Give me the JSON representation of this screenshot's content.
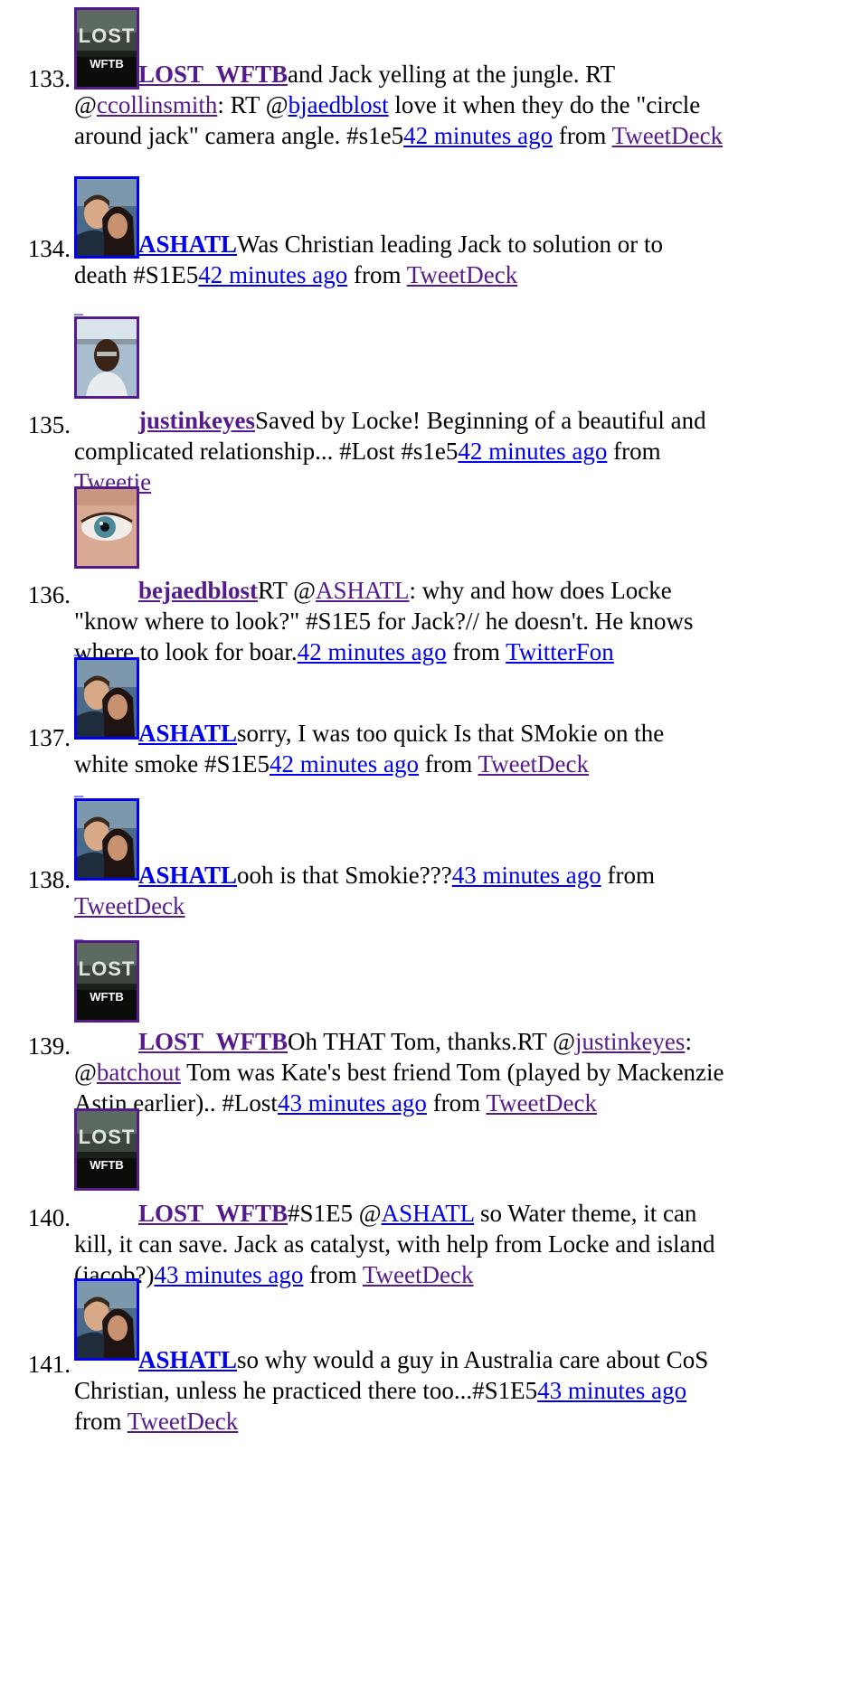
{
  "colors": {
    "link": "#0000ee",
    "visited": "#551a8b",
    "text": "#000000",
    "background": "#ffffff"
  },
  "tweets": [
    {
      "num": "133.",
      "avatar": "lost-wftb-logo",
      "avatar_caption": "WFTB",
      "username": "LOST_WFTB",
      "lines": [
        [
          [
            "t",
            "and Jack yelling at the jungle. RT"
          ]
        ],
        [
          [
            "t",
            "@"
          ],
          [
            "vl",
            "ccollinsmith"
          ],
          [
            "t",
            ": RT @"
          ],
          [
            "l",
            "bjaedblost"
          ],
          [
            "t",
            " love it when they do the \"circle"
          ]
        ],
        [
          [
            "t",
            "around jack\" camera angle. #s1e5"
          ],
          [
            "l",
            "42 minutes ago"
          ],
          [
            "t",
            " from "
          ],
          [
            "vl",
            "TweetDeck"
          ]
        ]
      ]
    },
    {
      "num": "134.",
      "avatar": "couple-photo",
      "username": "ASHATL",
      "lines": [
        [
          [
            "t",
            "Was Christian leading Jack to solution or to"
          ]
        ],
        [
          [
            "t",
            "death #S1E5"
          ],
          [
            "l",
            "42 minutes ago"
          ],
          [
            "t",
            " from "
          ],
          [
            "vl",
            "TweetDeck"
          ]
        ]
      ]
    },
    {
      "num": "135.",
      "avatar": "man-portrait",
      "username": "justinkeyes",
      "lines": [
        [
          [
            "t",
            "Saved by Locke! Beginning of a beautiful and"
          ]
        ],
        [
          [
            "t",
            "complicated relationship... #Lost #s1e5"
          ],
          [
            "l",
            "42 minutes ago"
          ],
          [
            "t",
            " from"
          ]
        ],
        [
          [
            "vl",
            "Tweetie"
          ]
        ]
      ]
    },
    {
      "num": "136.",
      "avatar": "eye-closeup",
      "username": "bejaedblost",
      "lines": [
        [
          [
            "t",
            "RT @"
          ],
          [
            "vl",
            "ASHATL"
          ],
          [
            "t",
            ": why and how does Locke"
          ]
        ],
        [
          [
            "t",
            "\"know where to look?\" #S1E5 for Jack?// he doesn't. He knows"
          ]
        ],
        [
          [
            "t",
            "where to look for boar."
          ],
          [
            "l",
            "42 minutes ago"
          ],
          [
            "t",
            " from "
          ],
          [
            "l",
            "TwitterFon"
          ]
        ]
      ]
    },
    {
      "num": "137.",
      "avatar": "couple-photo",
      "username": "ASHATL",
      "lines": [
        [
          [
            "t",
            "sorry, I was too quick Is that SMokie on the"
          ]
        ],
        [
          [
            "t",
            "white smoke #S1E5"
          ],
          [
            "l",
            "42 minutes ago"
          ],
          [
            "t",
            " from "
          ],
          [
            "vl",
            "TweetDeck"
          ]
        ]
      ]
    },
    {
      "num": "138.",
      "avatar": "couple-photo",
      "username": "ASHATL",
      "lines": [
        [
          [
            "t",
            "ooh is that Smokie???"
          ],
          [
            "l",
            "43 minutes ago"
          ],
          [
            "t",
            " from"
          ]
        ],
        [
          [
            "vl",
            "TweetDeck"
          ]
        ]
      ]
    },
    {
      "num": "139.",
      "avatar": "lost-wftb-logo",
      "avatar_caption": "WFTB",
      "username": "LOST_WFTB",
      "lines": [
        [
          [
            "t",
            "Oh THAT Tom, thanks.RT @"
          ],
          [
            "vl",
            "justinkeyes"
          ],
          [
            "t",
            ":"
          ]
        ],
        [
          [
            "t",
            "@"
          ],
          [
            "vl",
            "batchout"
          ],
          [
            "t",
            " Tom was Kate's best friend Tom (played by Mackenzie"
          ]
        ],
        [
          [
            "t",
            "Astin earlier).. #Lost"
          ],
          [
            "l",
            "43 minutes ago"
          ],
          [
            "t",
            " from "
          ],
          [
            "vl",
            "TweetDeck"
          ]
        ]
      ]
    },
    {
      "num": "140.",
      "avatar": "lost-wftb-logo",
      "avatar_caption": "WFTB",
      "username": "LOST_WFTB",
      "lines": [
        [
          [
            "t",
            "#S1E5 @"
          ],
          [
            "l",
            "ASHATL"
          ],
          [
            "t",
            " so Water theme, it can"
          ]
        ],
        [
          [
            "t",
            "kill, it can save. Jack as catalyst, with help from Locke and island"
          ]
        ],
        [
          [
            "t",
            "(jacob?)"
          ],
          [
            "l",
            "43 minutes ago"
          ],
          [
            "t",
            " from "
          ],
          [
            "vl",
            "TweetDeck"
          ]
        ]
      ]
    },
    {
      "num": "141.",
      "avatar": "couple-photo",
      "username": "ASHATL",
      "lines": [
        [
          [
            "t",
            "so why would a guy in Australia care about CoS"
          ]
        ],
        [
          [
            "t",
            "Christian, unless he practiced there too...#S1E5"
          ],
          [
            "l",
            "43 minutes ago"
          ]
        ],
        [
          [
            "t",
            "from "
          ],
          [
            "vl",
            "TweetDeck"
          ]
        ]
      ]
    }
  ]
}
